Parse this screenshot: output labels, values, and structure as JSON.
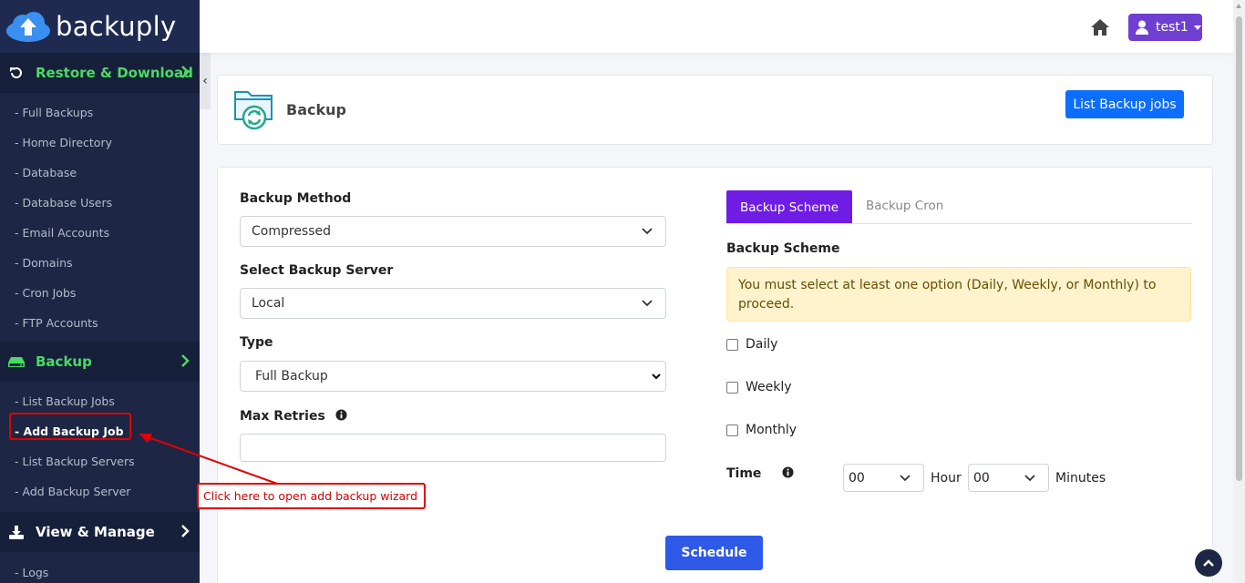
{
  "brand": {
    "name": "backuply"
  },
  "sidebar": {
    "sections": [
      {
        "title": "Restore & Download",
        "icon": "restore-icon",
        "color": "#4cd964",
        "items": [
          "- Full Backups",
          "- Home Directory",
          "- Database",
          "- Database Users",
          "- Email Accounts",
          "- Domains",
          "- Cron Jobs",
          "- FTP Accounts"
        ]
      },
      {
        "title": "Backup",
        "icon": "drive-icon",
        "color": "#4cd964",
        "items": [
          "- List Backup Jobs",
          "- Add Backup Job",
          "- List Backup Servers",
          "- Add Backup Server"
        ],
        "active_item": "- Add Backup Job"
      },
      {
        "title": "View & Manage",
        "icon": "download-icon",
        "color": "#ffffff",
        "items": [
          "- Logs"
        ]
      }
    ]
  },
  "topbar": {
    "username": "test1",
    "accent": "#6f3fd2"
  },
  "header": {
    "title": "Backup",
    "list_button": "List Backup jobs"
  },
  "form": {
    "backup_method": {
      "label": "Backup Method",
      "value": "Compressed"
    },
    "backup_server": {
      "label": "Select Backup Server",
      "value": "Local"
    },
    "type": {
      "label": "Type",
      "value": "Full Backup"
    },
    "max_retries": {
      "label": "Max Retries",
      "value": ""
    },
    "schedule_button": "Schedule"
  },
  "scheme": {
    "tabs": [
      "Backup Scheme",
      "Backup Cron"
    ],
    "title": "Backup Scheme",
    "alert": "You must select at least one option (Daily, Weekly, or Monthly) to proceed.",
    "options": [
      "Daily",
      "Weekly",
      "Monthly"
    ],
    "time_label": "Time",
    "hour_value": "00",
    "hour_label": "Hour",
    "minute_value": "00",
    "minute_label": "Minutes"
  },
  "annotation": {
    "callout": "Click here to open add backup wizard",
    "color": "#e00000"
  }
}
